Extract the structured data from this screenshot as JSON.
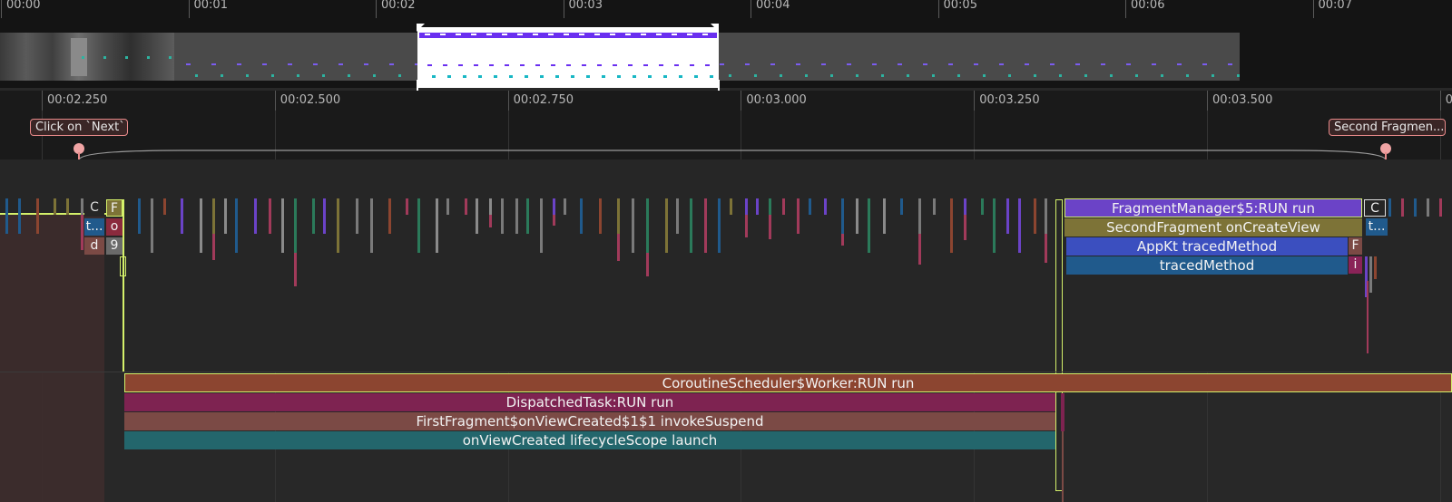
{
  "overview": {
    "ticks": [
      "00:00",
      "00:01",
      "00:02",
      "00:03",
      "00:04",
      "00:05",
      "00:06",
      "00:07"
    ]
  },
  "timeline": {
    "ticks": [
      "00:02.250",
      "00:02.500",
      "00:02.750",
      "00:03.000",
      "00:03.250",
      "00:03.500",
      "0"
    ]
  },
  "markers": {
    "start_label": "Click on `Next`",
    "end_label": "Second Fragmen..."
  },
  "main_thread": {
    "left_stub": {
      "c": "C",
      "f": "F",
      "t": "t...",
      "o": "o",
      "d": "d",
      "nine": "9"
    },
    "right": {
      "fragment_manager": "FragmentManager$5:RUN run",
      "second_fragment": "SecondFragment onCreateView",
      "appkt": "AppKt tracedMethod",
      "traced": "tracedMethod",
      "c": "C",
      "t": "t...",
      "f": "F",
      "i": "i"
    }
  },
  "worker_thread": {
    "coroutine": "CoroutineScheduler$Worker:RUN run",
    "dispatched": "DispatchedTask:RUN run",
    "first_fragment": "FirstFragment$onViewCreated$1$1 invokeSuspend",
    "on_view_created": "onViewCreated lifecycleScope launch"
  },
  "colors": {
    "background": "#282828",
    "overview_bg": "#141414",
    "selection_accent": "#d4f06a",
    "marker_accent": "#e88a8a",
    "coroutine": "#8c4530",
    "dispatched": "#7e2351",
    "first_fragment": "#7b4a45",
    "on_view_created": "#23666c",
    "fragment_manager": "#6b43c7",
    "second_fragment": "#7d7337",
    "appkt": "#3b4fbf",
    "traced": "#205a8c"
  }
}
